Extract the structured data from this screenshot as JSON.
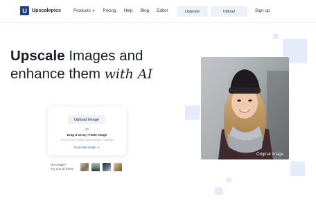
{
  "brand": {
    "logo_letter": "U",
    "name": "Upscalepics"
  },
  "nav": {
    "items": [
      {
        "label": "Products",
        "has_caret": true
      },
      {
        "label": "Pricing"
      },
      {
        "label": "Help"
      },
      {
        "label": "Blog"
      },
      {
        "label": "Editor"
      }
    ],
    "caret_glyph": "▼",
    "upgrade_label": "Upgrade",
    "upload_label": "Upload",
    "signup_label": "Sign up"
  },
  "hero": {
    "word_highlight": "Upscale",
    "line1_rest": " Images and",
    "line2_start": "enhance them ",
    "line2_script": "with AI"
  },
  "card": {
    "button_label": "Upload Image",
    "or_text": "Or",
    "drop_text": "Drag & Drop | Paste Image",
    "formats_text": "JPG or PNG or WebP upto 40MOps x 40MOps",
    "generate_label": "Generate Image",
    "generate_icon": "spark-icon"
  },
  "samples": {
    "prompt_line1": "No Image?",
    "prompt_line2": "Try one of these."
  },
  "photo": {
    "caption": "Original Image"
  },
  "colors": {
    "brand": "#1d3f8a",
    "accent_soft": "#e3ecf8",
    "link": "#2e58b8"
  }
}
